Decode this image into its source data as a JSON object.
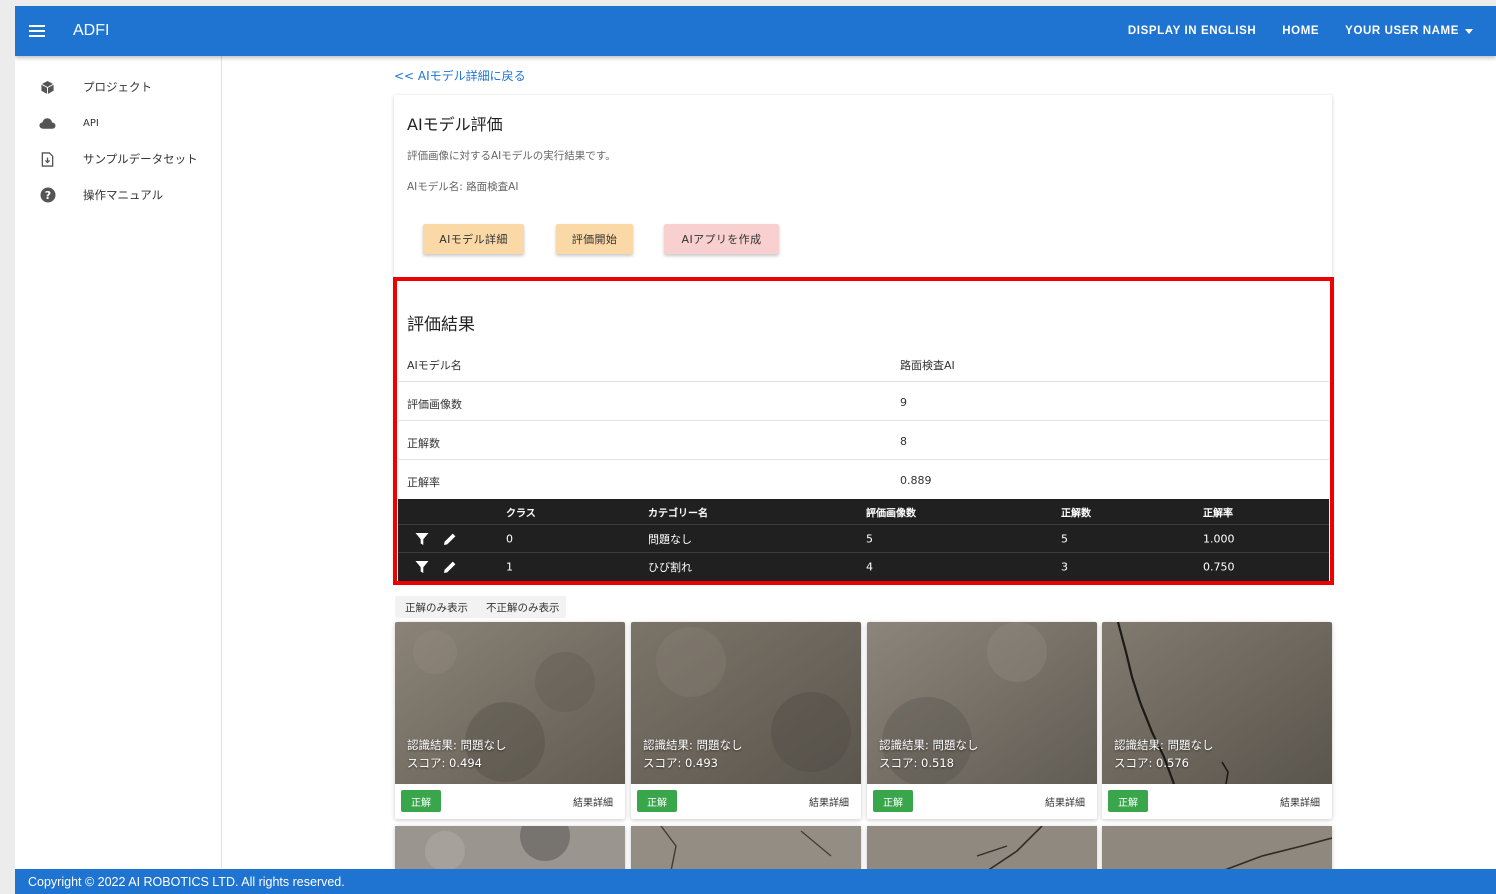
{
  "app": {
    "brand": "ADFI"
  },
  "header": {
    "links": [
      {
        "label": "DISPLAY IN ENGLISH"
      },
      {
        "label": "HOME"
      },
      {
        "label": "YOUR USER NAME"
      }
    ],
    "accent": "#1f74d2"
  },
  "sidebar": {
    "items": [
      {
        "label": "プロジェクト",
        "icon": "cube-icon"
      },
      {
        "label": "API",
        "icon": "cloud-icon"
      },
      {
        "label": "サンプルデータセット",
        "icon": "file-download-icon"
      },
      {
        "label": "操作マニュアル",
        "icon": "help-circle-icon"
      }
    ]
  },
  "main": {
    "back_link": "<< AIモデル詳細に戻る",
    "title": "AIモデル評価",
    "description": "評価画像に対するAIモデルの実行結果です。",
    "model_line": "AIモデル名: 路面検査AI",
    "buttons": {
      "detail": "AIモデル詳細",
      "start": "評価開始",
      "create_app": "AIアプリを作成"
    }
  },
  "result": {
    "title": "評価結果",
    "rows": [
      {
        "key": "AIモデル名",
        "value": "路面検査AI"
      },
      {
        "key": "評価画像数",
        "value": "9"
      },
      {
        "key": "正解数",
        "value": "8"
      },
      {
        "key": "正解率",
        "value": "0.889"
      }
    ],
    "table": {
      "headers": {
        "class": "クラス",
        "category": "カテゴリー名",
        "images": "評価画像数",
        "correct": "正解数",
        "rate": "正解率"
      },
      "rows": [
        {
          "class": "0",
          "category": "問題なし",
          "images": "5",
          "correct": "5",
          "rate": "1.000"
        },
        {
          "class": "1",
          "category": "ひび割れ",
          "images": "4",
          "correct": "3",
          "rate": "0.750"
        }
      ]
    },
    "highlight_color": "#ee0000"
  },
  "filters": {
    "correct_only": "正解のみ表示",
    "incorrect_only": "不正解のみ表示"
  },
  "gallery": {
    "cards": [
      {
        "result": "認識結果: 問題なし",
        "score": "スコア: 0.494",
        "badge": "正解",
        "detail": "結果詳細"
      },
      {
        "result": "認識結果: 問題なし",
        "score": "スコア: 0.493",
        "badge": "正解",
        "detail": "結果詳細"
      },
      {
        "result": "認識結果: 問題なし",
        "score": "スコア: 0.518",
        "badge": "正解",
        "detail": "結果詳細"
      },
      {
        "result": "認識結果: 問題なし",
        "score": "スコア: 0.576",
        "badge": "正解",
        "detail": "結果詳細"
      }
    ]
  },
  "footer": {
    "text": "Copyright © 2022 AI ROBOTICS LTD. All rights reserved."
  }
}
